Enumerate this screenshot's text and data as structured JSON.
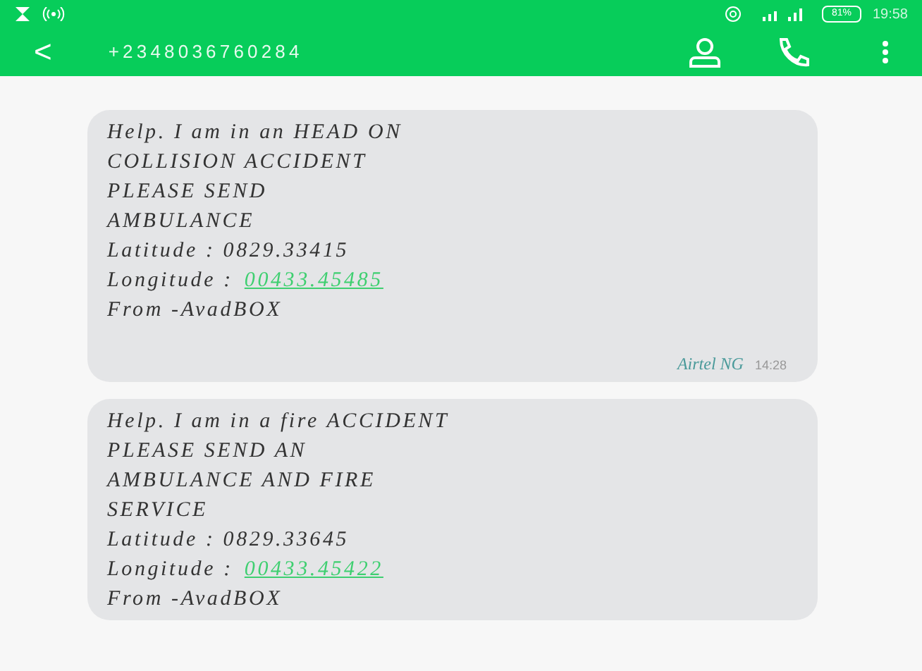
{
  "status_bar": {
    "time": "19:58",
    "battery": "81%"
  },
  "header": {
    "back": "<",
    "contact": "+2348036760284"
  },
  "messages": [
    {
      "body": "Help. I am in an HEAD ON\nCOLLISION ACCIDENT\nPLEASE SEND\nAMBULANCE",
      "latitude": "Latitude : 0829.33415",
      "longitude_label": "Longitude :",
      "longitude": "00433.45485",
      "from": "From -AvadBOX",
      "carrier": "Airtel NG",
      "time": "14:28"
    },
    {
      "body": "Help. I am in a fire ACCIDENT\nPLEASE SEND AN\nAMBULANCE AND FIRE\nSERVICE",
      "latitude": "Latitude : 0829.33645",
      "longitude_label": "Longitude :",
      "longitude": "00433.45422",
      "from": "From -AvadBOX"
    }
  ]
}
